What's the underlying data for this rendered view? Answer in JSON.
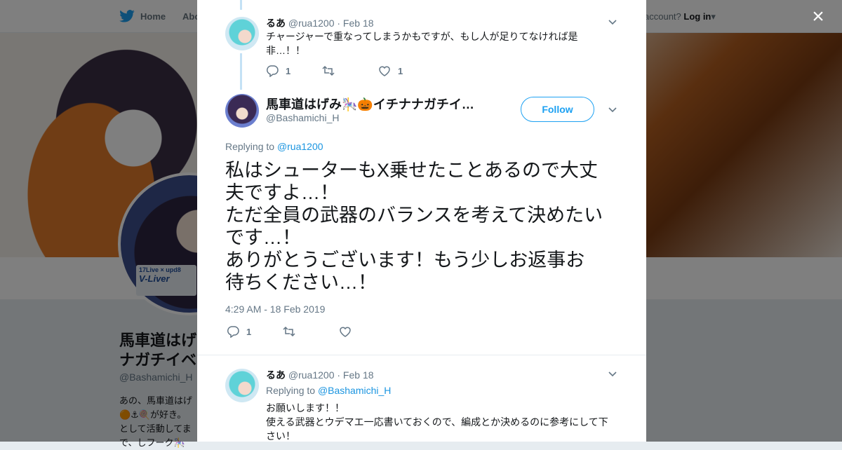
{
  "nav": {
    "home_label": "Home",
    "about_label": "Abo",
    "account_prompt": "account?",
    "login_label": "Log in",
    "login_caret": "▾"
  },
  "background_profile": {
    "name_line1": "馬車道はげ",
    "name_line2": "ナガチイベ",
    "handle": "@Bashamichi_H",
    "bio_line1": "あの、馬車道はげ",
    "bio_line2": "🟠⚓🍭が好き。",
    "bio_line3": "として活動してま",
    "bio_line4": "で、しフーク🎠",
    "avatar_tag_line1": "17Live × upd8",
    "avatar_tag_line2": "V-Liver"
  },
  "close_label": "×",
  "tweets": {
    "prev": {
      "name": "るあ",
      "handle": "@rua1200",
      "date": "· Feb 18",
      "text_line1": "チャージャーで重なってしまうかもですが、もし人が足りてなければ是",
      "text_line2": "非…！！",
      "reply_count": "1",
      "retweet_count": "",
      "like_count": "1"
    },
    "main": {
      "name": "馬車道はげみ🎠🎃イチナナガチイ…",
      "handle": "@Bashamichi_H",
      "follow_label": "Follow",
      "replying_prefix": "Replying to",
      "replying_to": "@rua1200",
      "text_lines": [
        "私はシューターもX乗せたことあるので大丈",
        "夫ですよ…！",
        "ただ全員の武器のバランスを考えて決めたい",
        "です…！",
        "ありがとうございます！もう少しお返事お",
        "待ちください…！"
      ],
      "timestamp": "4:29 AM - 18 Feb 2019",
      "reply_count": "1",
      "retweet_count": "",
      "like_count": ""
    },
    "next": {
      "name": "るあ",
      "handle": "@rua1200",
      "date": "· Feb 18",
      "replying_prefix": "Replying to",
      "replying_to": "@Bashamichi_H",
      "text_lines": [
        "お願いします！！",
        "使える武器とウデマエ一応書いておくので、編成とか決めるのに参考にして下",
        "さい！"
      ]
    }
  },
  "icons": {
    "reply": "reply-icon",
    "retweet": "retweet-icon",
    "like": "heart-icon",
    "chevron": "chevron-down-icon",
    "twitter": "twitter-bird-icon",
    "close": "close-icon"
  },
  "colors": {
    "accent": "#1da1f2",
    "link": "#1b95e0",
    "muted": "#657786",
    "text": "#14171a",
    "thread_line": "#c4e1f5"
  }
}
